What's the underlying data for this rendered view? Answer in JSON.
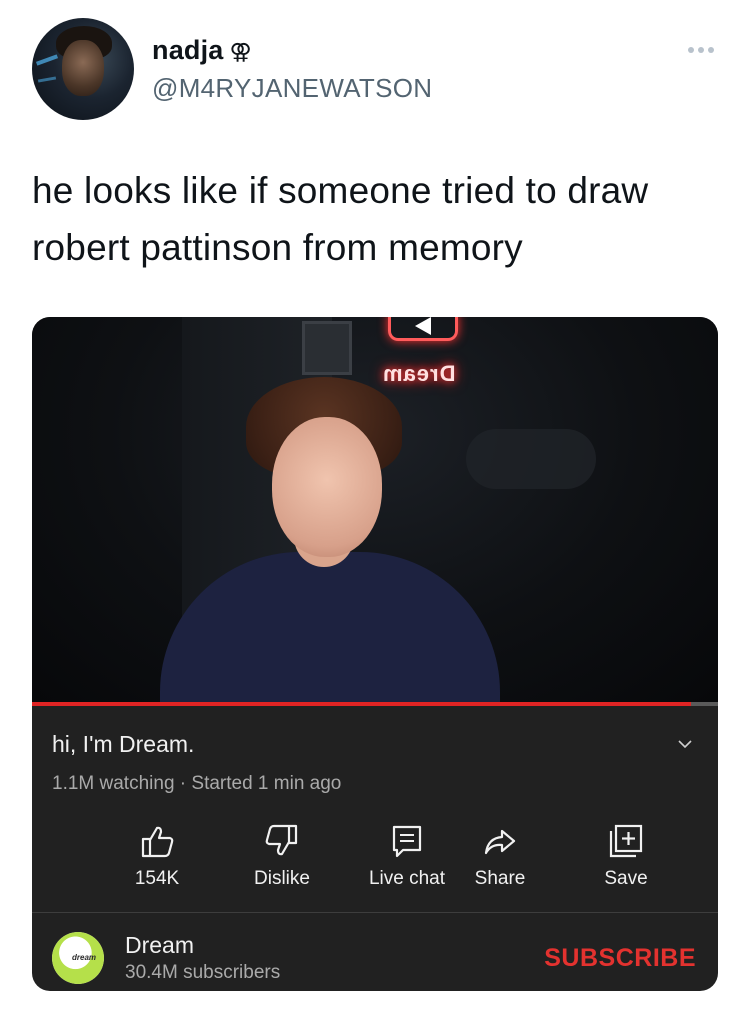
{
  "tweet": {
    "display_name": "nadja",
    "name_symbol": "⚢",
    "handle": "@M4RYJANEWATSON",
    "text": "he looks like if someone tried to draw robert pattinson from memory"
  },
  "video": {
    "neon_sign": "Dream",
    "progress": 0.96,
    "progress_color": "#e02424",
    "title": "hi, I'm Dream.",
    "meta": "1.1M watching · Started 1 min ago",
    "actions": [
      {
        "label": "154K",
        "icon": "thumbs-up-icon"
      },
      {
        "label": "Dislike",
        "icon": "thumbs-down-icon"
      },
      {
        "label": "Live chat",
        "icon": "chat-icon"
      },
      {
        "label": "Share",
        "icon": "share-icon"
      },
      {
        "label": "Save",
        "icon": "save-to-playlist-icon"
      }
    ]
  },
  "channel": {
    "avatar_text": "dream",
    "name": "Dream",
    "subscribers": "30.4M subscribers",
    "subscribe_label": "SUBSCRIBE",
    "subscribe_color": "#e3322f"
  }
}
